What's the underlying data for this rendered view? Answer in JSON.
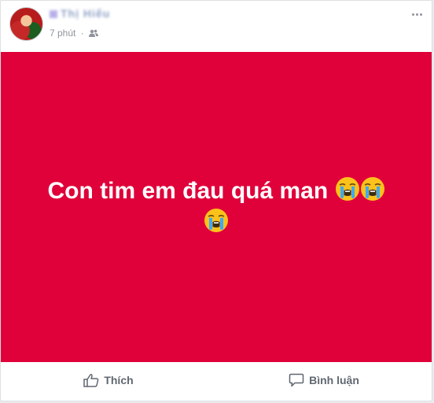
{
  "post": {
    "author_name": "Thị Hiếu",
    "time_label": "7 phút",
    "privacy_icon": "friends-icon",
    "more_icon": "more-options-icon"
  },
  "status_background": {
    "color": "#e0003a",
    "text": "Con tim em đau quá man"
  },
  "emoji": {
    "name": "loudly-crying-face",
    "count": 3
  },
  "actions": {
    "like_label": "Thích",
    "comment_label": "Bình luận"
  }
}
